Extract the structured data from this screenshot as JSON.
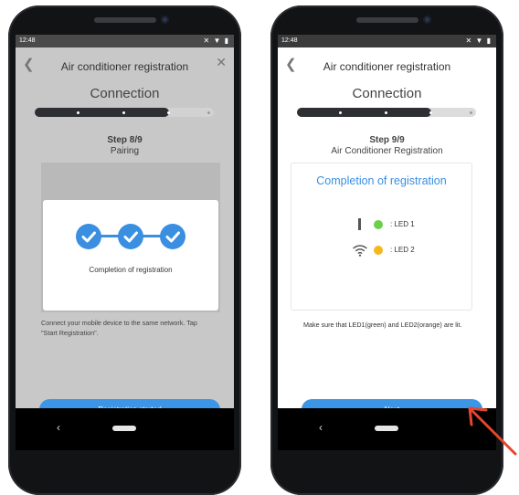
{
  "phones": {
    "left": {
      "status_time": "12:48",
      "status_icons": "✕ ▼ ▮",
      "title": "Air conditioner registration",
      "connection_title": "Connection",
      "progress_fraction": 0.75,
      "step_label": "Step 8/9",
      "step_sub": "Pairing",
      "card_text": "Completion of registration",
      "note": "Connect your mobile device to the same network. Tap \"Start Registration\".",
      "button_label": "Registration started"
    },
    "right": {
      "status_time": "12:48",
      "status_icons": "✕ ▼ ▮",
      "title": "Air conditioner registration",
      "connection_title": "Connection",
      "progress_fraction": 0.75,
      "step_label": "Step 9/9",
      "step_sub": "Air Conditioner Registration",
      "card_title": "Completion of registration",
      "led1_label": ": LED 1",
      "led2_label": ": LED 2",
      "note": "Make sure that LED1(green) and LED2(orange) are lit.",
      "button_label": "Next"
    }
  },
  "colors": {
    "accent": "#3d95e6",
    "led1": "#6ad04a",
    "led2": "#f5b81c",
    "arrow": "#e8452c"
  },
  "icons": [
    "back-icon",
    "close-icon",
    "check-icon",
    "led-bar-icon",
    "wifi-icon",
    "nav-back-icon",
    "nav-home-icon",
    "pointer-arrow-icon"
  ]
}
